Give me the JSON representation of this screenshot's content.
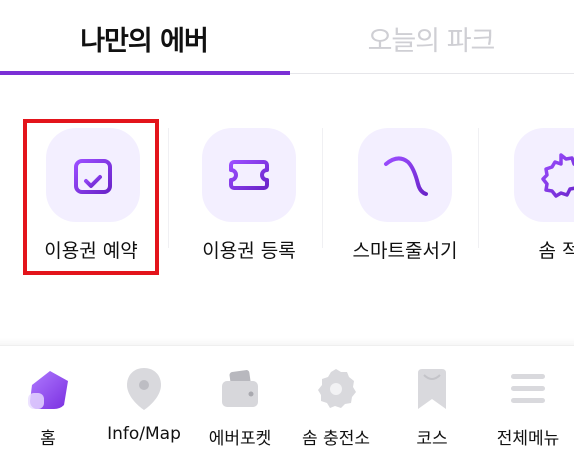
{
  "tabs": {
    "my": "나만의 에버",
    "today": "오늘의 파크"
  },
  "quick_menu": [
    {
      "label": "이용권 예약",
      "icon": "calendar-check-icon"
    },
    {
      "label": "이용권 등록",
      "icon": "ticket-plus-icon"
    },
    {
      "label": "스마트줄서기",
      "icon": "roller-coaster-icon"
    },
    {
      "label": "솜 적",
      "icon": "barcode-badge-icon"
    }
  ],
  "bottom_nav": [
    {
      "label": "홈",
      "icon": "home-icon"
    },
    {
      "label": "Info/Map",
      "icon": "map-pin-icon"
    },
    {
      "label": "에버포켓",
      "icon": "wallet-icon"
    },
    {
      "label": "솜 충전소",
      "icon": "coin-charge-icon"
    },
    {
      "label": "코스",
      "icon": "bookmark-icon"
    },
    {
      "label": "전체메뉴",
      "icon": "hamburger-menu-icon"
    }
  ],
  "colors": {
    "accent": "#7b2fd6",
    "icon_bg": "#f3efff",
    "highlight": "#e3141b"
  }
}
